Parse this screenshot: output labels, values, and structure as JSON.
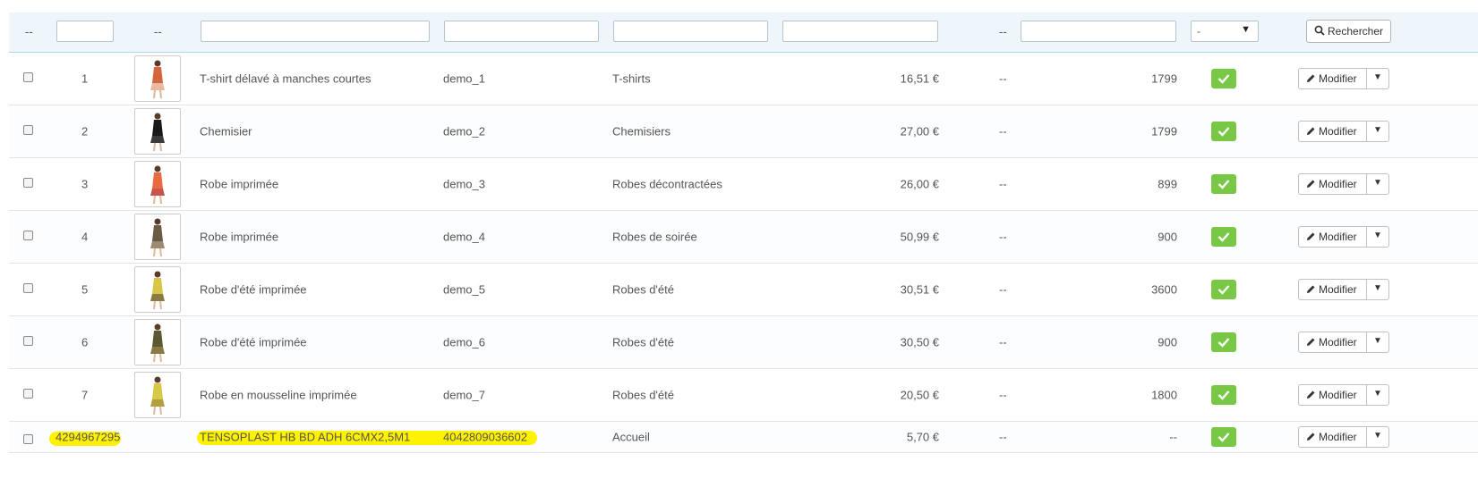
{
  "filters": {
    "dash": "--",
    "status_selected": "-",
    "search_label": "Rechercher"
  },
  "rows": [
    {
      "id": "1",
      "name": "T-shirt délavé à manches courtes",
      "ref": "demo_1",
      "category": "T-shirts",
      "price": "16,51 €",
      "col": "--",
      "qty": "1799"
    },
    {
      "id": "2",
      "name": "Chemisier",
      "ref": "demo_2",
      "category": "Chemisiers",
      "price": "27,00 €",
      "col": "--",
      "qty": "1799"
    },
    {
      "id": "3",
      "name": "Robe imprimée",
      "ref": "demo_3",
      "category": "Robes décontractées",
      "price": "26,00 €",
      "col": "--",
      "qty": "899"
    },
    {
      "id": "4",
      "name": "Robe imprimée",
      "ref": "demo_4",
      "category": "Robes de soirée",
      "price": "50,99 €",
      "col": "--",
      "qty": "900"
    },
    {
      "id": "5",
      "name": "Robe d'été imprimée",
      "ref": "demo_5",
      "category": "Robes d'été",
      "price": "30,51 €",
      "col": "--",
      "qty": "3600"
    },
    {
      "id": "6",
      "name": "Robe d'été imprimée",
      "ref": "demo_6",
      "category": "Robes d'été",
      "price": "30,50 €",
      "col": "--",
      "qty": "900"
    },
    {
      "id": "7",
      "name": "Robe en mousseline imprimée",
      "ref": "demo_7",
      "category": "Robes d'été",
      "price": "20,50 €",
      "col": "--",
      "qty": "1800"
    }
  ],
  "last_row": {
    "id": "4294967295",
    "name": "TENSOPLAST HB BD ADH 6CMX2,5M1",
    "ref": "4042809036602",
    "category": "Accueil",
    "price": "5,70 €",
    "col": "--",
    "qty": "--"
  },
  "actions": {
    "edit_label": "Modifier"
  },
  "colors": {
    "status_green": "#78c846",
    "highlight": "#fff200",
    "filter_bg": "#eef6fc"
  }
}
